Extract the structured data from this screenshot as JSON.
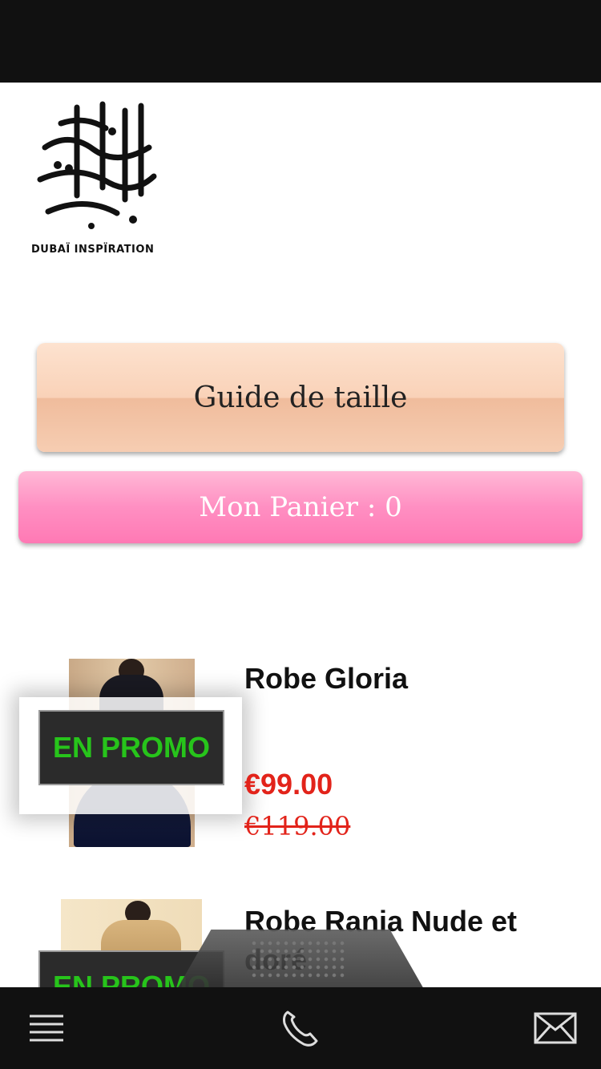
{
  "brand": {
    "logo_name": "dubai-inspiration-logo",
    "caption": "DUBAÏ INSPÏRATION"
  },
  "buttons": {
    "size_guide": "Guide de taille",
    "cart": "Mon Panier : 0"
  },
  "products": [
    {
      "name": "Robe Gloria",
      "badge": "EN PROMO",
      "price": "€99.00",
      "old_price": "€119.00"
    },
    {
      "name": "Robe Rania Nude et doré",
      "badge": "EN PROMO"
    }
  ],
  "tabbar": {
    "icons": [
      "menu-icon",
      "phone-icon",
      "mail-icon"
    ]
  },
  "colors": {
    "promo_text": "#27c41b",
    "price": "#e2231a",
    "cart_button": "#ff8fc2",
    "guide_button": "#f9d2b8"
  }
}
